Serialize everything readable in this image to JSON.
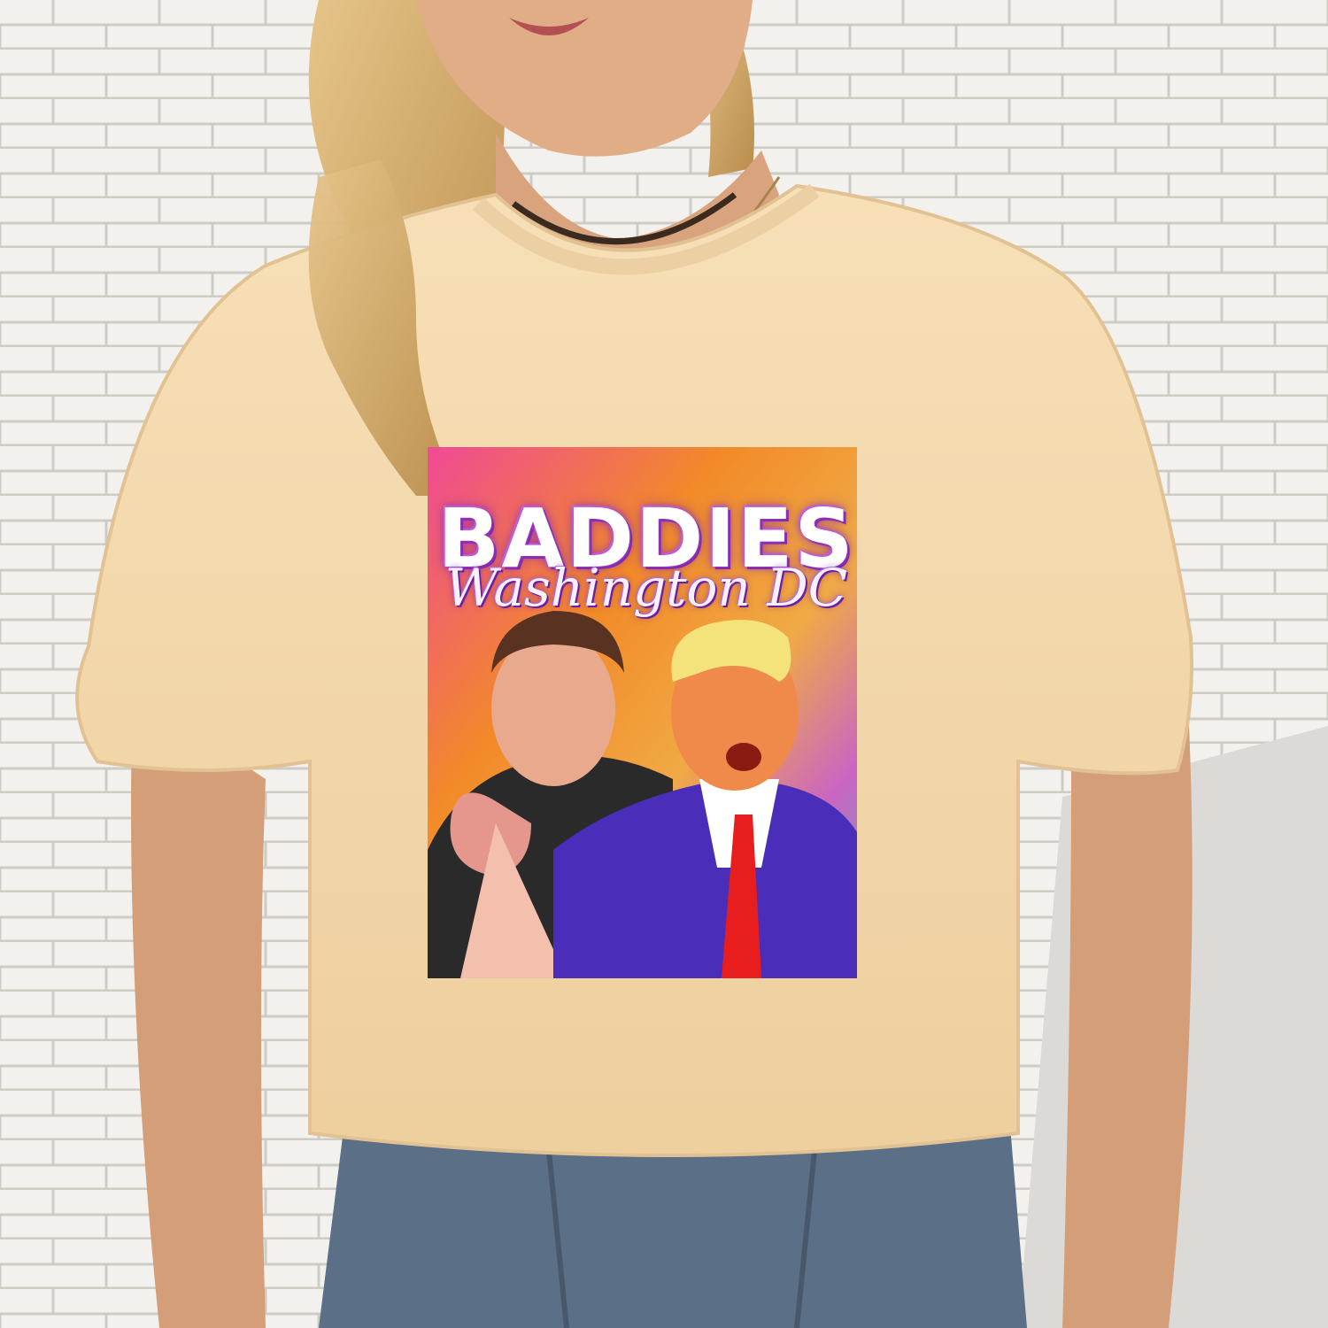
{
  "scene": {
    "description_colors": {
      "wall": "#f3f2ef",
      "mortar": "#c9c6c1",
      "shirt": "#f6dcb2",
      "jeans": "#5b6f86",
      "hair": "#d9b36e",
      "foliage": "#2f3e2a"
    }
  },
  "print": {
    "title": "BADDIES",
    "subtitle": "Washington DC"
  }
}
